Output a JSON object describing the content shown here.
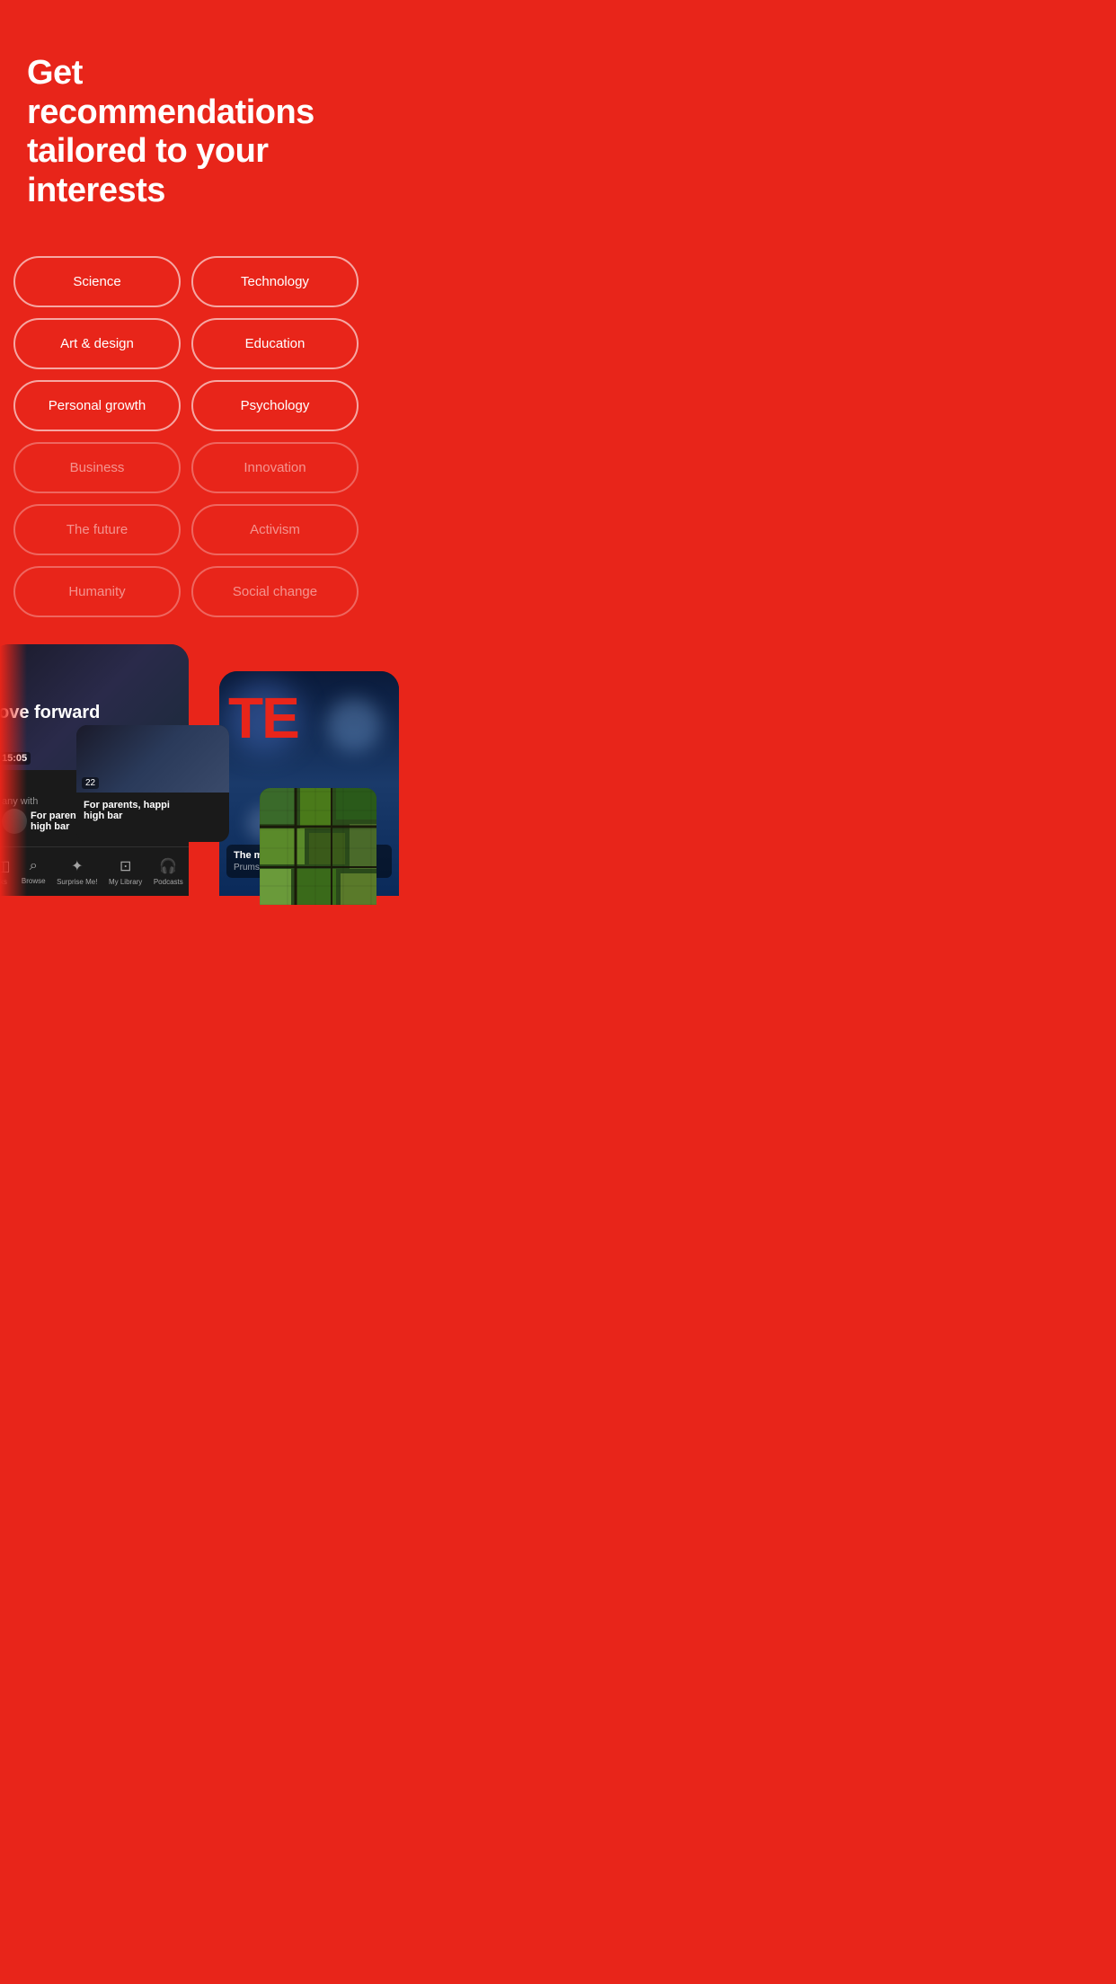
{
  "page": {
    "background_color": "#e8251a",
    "headline": "Get recommendations tailored to your interests"
  },
  "interests": {
    "items": [
      {
        "label": "Science",
        "row": 1,
        "col": 1,
        "faded": false
      },
      {
        "label": "Technology",
        "row": 1,
        "col": 2,
        "faded": false
      },
      {
        "label": "Art & design",
        "row": 2,
        "col": 1,
        "faded": false
      },
      {
        "label": "Education",
        "row": 2,
        "col": 2,
        "faded": false
      },
      {
        "label": "Personal growth",
        "row": 3,
        "col": 1,
        "faded": false
      },
      {
        "label": "Psychology",
        "row": 3,
        "col": 2,
        "faded": false
      },
      {
        "label": "Business",
        "row": 4,
        "col": 1,
        "faded": true
      },
      {
        "label": "Innovation",
        "row": 4,
        "col": 2,
        "faded": true
      },
      {
        "label": "The future",
        "row": 5,
        "col": 1,
        "faded": true
      },
      {
        "label": "Activism",
        "row": 5,
        "col": 2,
        "faded": true
      },
      {
        "label": "Humanity",
        "row": 6,
        "col": 1,
        "faded": true
      },
      {
        "label": "Social change",
        "row": 6,
        "col": 2,
        "faded": true
      }
    ]
  },
  "bottom_overlay": {
    "left_device": {
      "video_duration": "15:05",
      "scroll_text": "ove forward",
      "video_title1": "For parents, happi",
      "video_title2": "high bar",
      "video_subtitle": "any with",
      "nav_items": [
        {
          "label": "ks",
          "icon": "◁"
        },
        {
          "label": "Browse",
          "icon": "⌕"
        },
        {
          "label": "Surprise Me!",
          "icon": "✦"
        },
        {
          "label": "My Library",
          "icon": "⊡"
        },
        {
          "label": "Podcasts",
          "icon": "🎧"
        }
      ]
    },
    "right_device": {
      "ted_text": "TE",
      "caption": "The magi",
      "author": "Prumsodun"
    }
  }
}
